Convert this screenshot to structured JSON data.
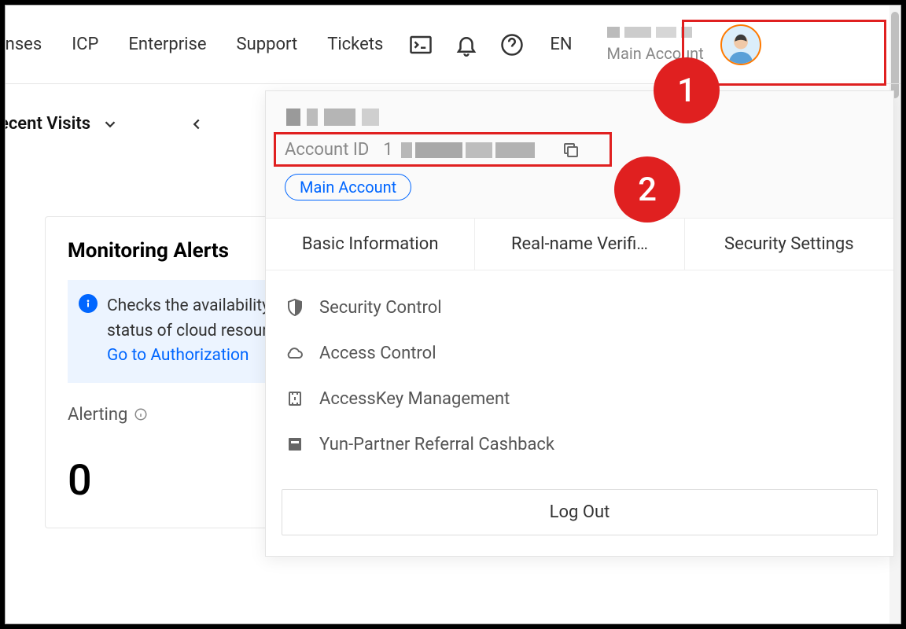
{
  "nav": {
    "items": [
      "enses",
      "ICP",
      "Enterprise",
      "Support",
      "Tickets"
    ],
    "lang": "EN",
    "account_label": "Main Account"
  },
  "annotations": {
    "step1": "1",
    "step2": "2"
  },
  "recent": {
    "label": "ecent Visits"
  },
  "monitor": {
    "title": "Monitoring Alerts",
    "banner_line1": "Checks the availability and",
    "banner_line2": "status of cloud resources.",
    "banner_link": "Go to Authorization",
    "alerting_label": "Alerting",
    "alerting_count": "0"
  },
  "dropdown": {
    "account_id_label": "Account ID",
    "account_id_first_char": "1",
    "main_account_pill": "Main Account",
    "tabs": [
      "Basic Information",
      "Real-name Verifi…",
      "Security Settings"
    ],
    "items": [
      {
        "icon": "shield",
        "label": "Security Control"
      },
      {
        "icon": "cloud",
        "label": "Access Control"
      },
      {
        "icon": "key",
        "label": "AccessKey Management"
      },
      {
        "icon": "cashback",
        "label": "Yun-Partner Referral Cashback"
      }
    ],
    "logout": "Log Out"
  }
}
